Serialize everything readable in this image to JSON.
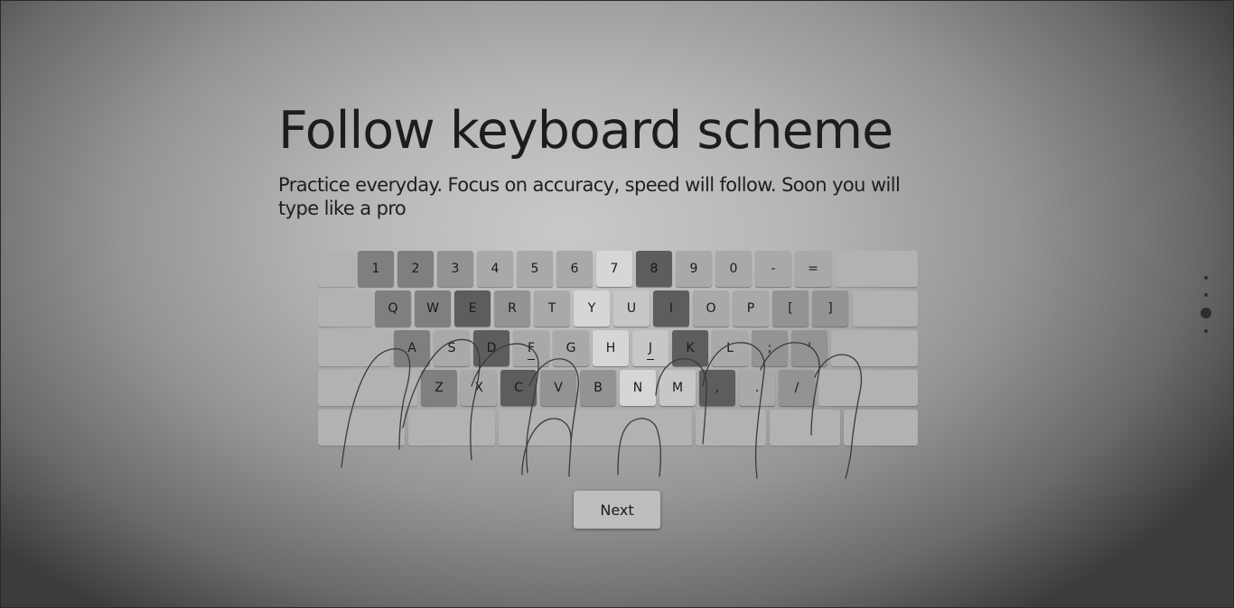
{
  "heading": {
    "title": "Follow keyboard scheme",
    "subtitle": "Practice everyday. Focus on accuracy, speed will follow. Soon you will type like a pro"
  },
  "keyboard": {
    "number_row": [
      "1",
      "2",
      "3",
      "4",
      "5",
      "6",
      "7",
      "8",
      "9",
      "0",
      "-",
      "="
    ],
    "top_row": [
      "Q",
      "W",
      "E",
      "R",
      "T",
      "Y",
      "U",
      "I",
      "O",
      "P",
      "[",
      "]"
    ],
    "home_row": [
      "A",
      "S",
      "D",
      "F",
      "G",
      "H",
      "J",
      "K",
      "L",
      ";",
      "'"
    ],
    "bottom_row": [
      "Z",
      "X",
      "C",
      "V",
      "B",
      "N",
      "M",
      ",",
      ".",
      "/"
    ]
  },
  "next_button": {
    "label": "Next"
  },
  "pager": {
    "pages": 4,
    "active_index": 2
  }
}
